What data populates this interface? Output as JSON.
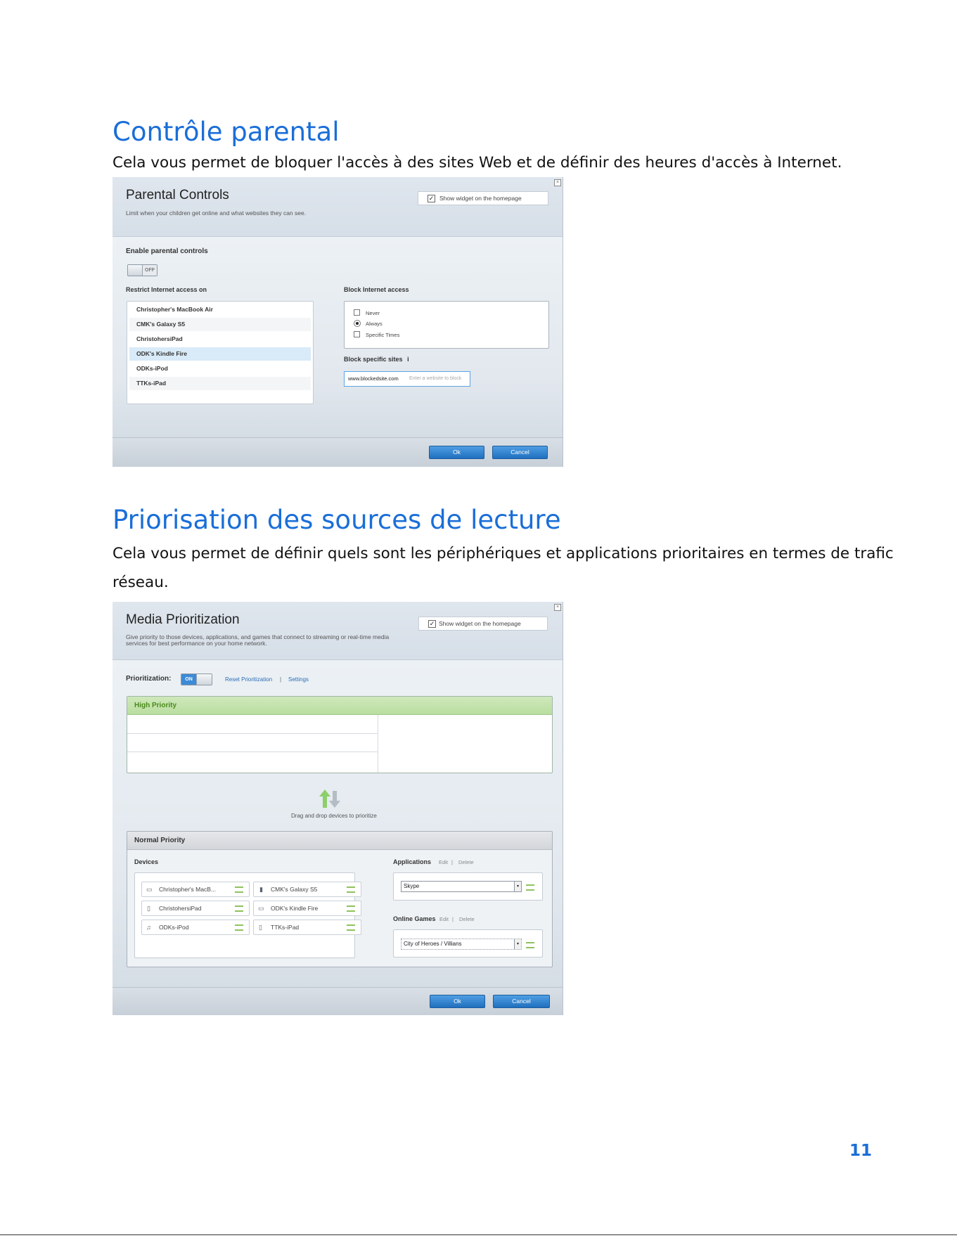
{
  "section1": {
    "heading": "Contrôle parental",
    "description": "Cela vous permet de bloquer l'accès à des sites Web et de définir des heures d'accès à Internet."
  },
  "parental": {
    "title": "Parental Controls",
    "subtitle": "Limit when your children get online and what websites they can see.",
    "widget_label": "Show widget on the homepage",
    "enable_label": "Enable parental controls",
    "toggle_state": "OFF",
    "restrict_label": "Restrict Internet access on",
    "devices": [
      "Christopher's MacBook Air",
      "CMK's Galaxy S5",
      "ChristohersiPad",
      "ODK's Kindle Fire",
      "ODKs-iPod",
      "TTKs-iPad"
    ],
    "block_label": "Block Internet access",
    "block_options": [
      "Never",
      "Always",
      "Specific Times"
    ],
    "block_selected": "Always",
    "sites_label": "Block specific sites",
    "sites_value": "www.blockedsite.com",
    "sites_placeholder": "Enter a website to block",
    "ok_label": "Ok",
    "cancel_label": "Cancel"
  },
  "section2": {
    "heading": "Priorisation des sources de lecture",
    "description_line1": "Cela vous permet de définir quels sont les périphériques et applications prioritaires en termes de trafic",
    "description_line2": "réseau."
  },
  "media": {
    "title": "Media Prioritization",
    "subtitle_line1": "Give priority to those devices, applications, and games that connect to streaming or real-time media",
    "subtitle_line2": "services for best performance on your home network.",
    "widget_label": "Show widget on the homepage",
    "prioritization_label": "Prioritization:",
    "toggle_state": "ON",
    "reset_link": "Reset Prioritization",
    "settings_link": "Settings",
    "high_priority": "High Priority",
    "drag_hint": "Drag and drop devices to prioritize",
    "normal_priority": "Normal Priority",
    "devices_label": "Devices",
    "devices": [
      {
        "name": "Christopher's MacB...",
        "icon": "laptop-icon"
      },
      {
        "name": "CMK's Galaxy S5",
        "icon": "phone-icon"
      },
      {
        "name": "ChristohersiPad",
        "icon": "tablet-icon"
      },
      {
        "name": "ODK's Kindle Fire",
        "icon": "ereader-icon"
      },
      {
        "name": "ODKs-iPod",
        "icon": "music-player-icon"
      },
      {
        "name": "TTKs-iPad",
        "icon": "tablet-icon"
      }
    ],
    "applications_label": "Applications",
    "edit_label": "Edit",
    "delete_label": "Delete",
    "application_value": "Skype",
    "games_label": "Online Games",
    "game_value": "City of Heroes / Villians",
    "ok_label": "Ok",
    "cancel_label": "Cancel"
  },
  "page_number": "11"
}
